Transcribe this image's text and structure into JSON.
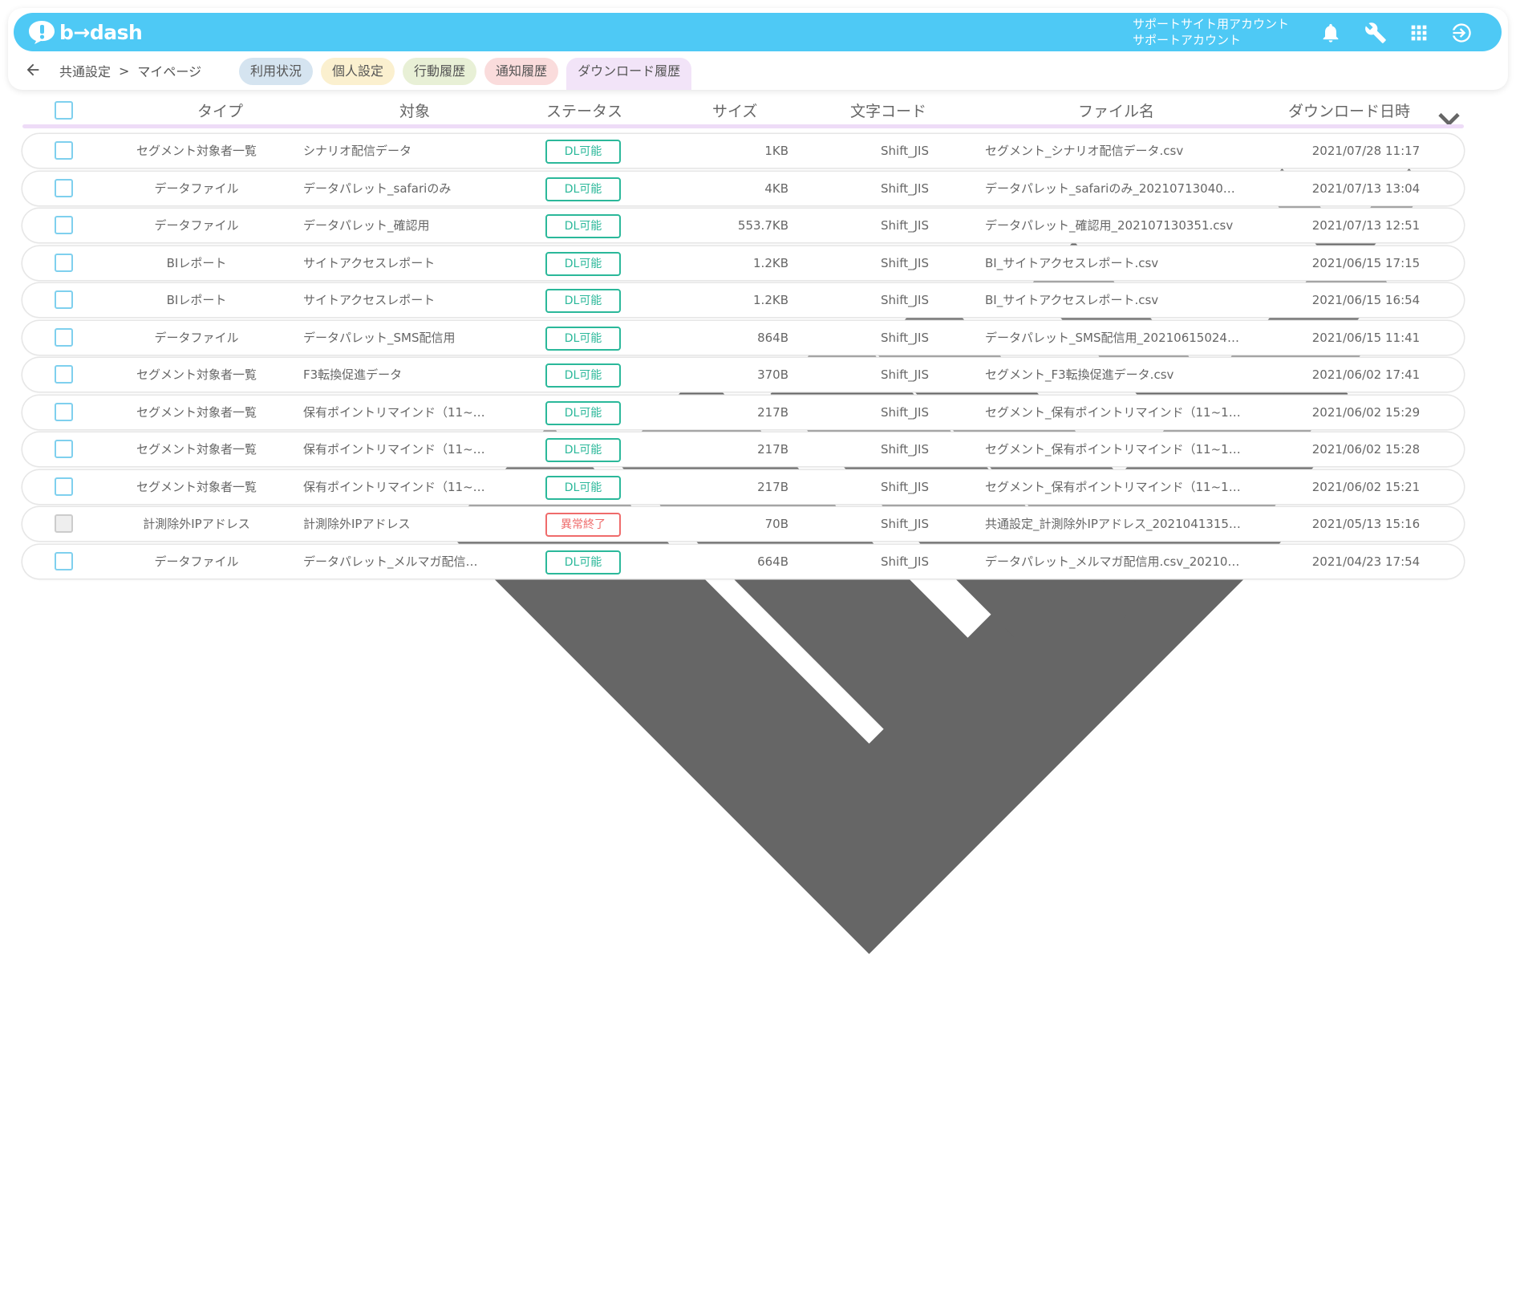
{
  "app": {
    "logo_text": "b→dash",
    "account_line1": "サポートサイト用アカウント",
    "account_line2": "サポートアカウント",
    "icons": [
      "bell-icon",
      "wrench-icon",
      "grid-icon",
      "logout-icon"
    ]
  },
  "breadcrumb": {
    "root": "共通設定",
    "separator": ">",
    "current": "マイページ"
  },
  "tabs": [
    {
      "label": "利用状況",
      "color": "#d5e4f0"
    },
    {
      "label": "個人設定",
      "color": "#fbf0cf"
    },
    {
      "label": "行動履歴",
      "color": "#e8f0d6"
    },
    {
      "label": "通知履歴",
      "color": "#fadcdc"
    },
    {
      "label": "ダウンロード履歴",
      "color": "#f2e4f8",
      "active": true
    }
  ],
  "columns": {
    "type": "タイプ",
    "target": "対象",
    "status": "ステータス",
    "size": "サイズ",
    "encoding": "文字コード",
    "filename": "ファイル名",
    "date": "ダウンロード日時"
  },
  "colors": {
    "topbar": "#4ec9f5",
    "status_ok": "#2bb89a",
    "status_err": "#ef6b6b",
    "header_line": "#eedcf7",
    "checkbox": "#7fd0ee"
  },
  "rows": [
    {
      "type": "セグメント対象者一覧",
      "target": "シナリオ配信データ",
      "status": "DL可能",
      "size": "1KB",
      "encoding": "Shift_JIS",
      "filename": "セグメント_シナリオ配信データ.csv",
      "date": "2021/07/28 11:17"
    },
    {
      "type": "データファイル",
      "target": "データパレット_safariのみ",
      "status": "DL可能",
      "size": "4KB",
      "encoding": "Shift_JIS",
      "filename": "データパレット_safariのみ_20210713040…",
      "date": "2021/07/13 13:04"
    },
    {
      "type": "データファイル",
      "target": "データパレット_確認用",
      "status": "DL可能",
      "size": "553.7KB",
      "encoding": "Shift_JIS",
      "filename": "データパレット_確認用_202107130351.csv",
      "date": "2021/07/13 12:51"
    },
    {
      "type": "BIレポート",
      "target": "サイトアクセスレポート",
      "status": "DL可能",
      "size": "1.2KB",
      "encoding": "Shift_JIS",
      "filename": "BI_サイトアクセスレポート.csv",
      "date": "2021/06/15 17:15"
    },
    {
      "type": "BIレポート",
      "target": "サイトアクセスレポート",
      "status": "DL可能",
      "size": "1.2KB",
      "encoding": "Shift_JIS",
      "filename": "BI_サイトアクセスレポート.csv",
      "date": "2021/06/15 16:54"
    },
    {
      "type": "データファイル",
      "target": "データパレット_SMS配信用",
      "status": "DL可能",
      "size": "864B",
      "encoding": "Shift_JIS",
      "filename": "データパレット_SMS配信用_20210615024…",
      "date": "2021/06/15 11:41"
    },
    {
      "type": "セグメント対象者一覧",
      "target": "F3転換促進データ",
      "status": "DL可能",
      "size": "370B",
      "encoding": "Shift_JIS",
      "filename": "セグメント_F3転換促進データ.csv",
      "date": "2021/06/02 17:41"
    },
    {
      "type": "セグメント対象者一覧",
      "target": "保有ポイントリマインド（11~…",
      "status": "DL可能",
      "size": "217B",
      "encoding": "Shift_JIS",
      "filename": "セグメント_保有ポイントリマインド（11~1…",
      "date": "2021/06/02 15:29"
    },
    {
      "type": "セグメント対象者一覧",
      "target": "保有ポイントリマインド（11~…",
      "status": "DL可能",
      "size": "217B",
      "encoding": "Shift_JIS",
      "filename": "セグメント_保有ポイントリマインド（11~1…",
      "date": "2021/06/02 15:28"
    },
    {
      "type": "セグメント対象者一覧",
      "target": "保有ポイントリマインド（11~…",
      "status": "DL可能",
      "size": "217B",
      "encoding": "Shift_JIS",
      "filename": "セグメント_保有ポイントリマインド（11~1…",
      "date": "2021/06/02 15:21"
    },
    {
      "type": "計測除外IPアドレス",
      "target": "計測除外IPアドレス",
      "status": "異常終了",
      "size": "70B",
      "encoding": "Shift_JIS",
      "filename": "共通設定_計測除外IPアドレス_2021041315…",
      "date": "2021/05/13 15:16",
      "error": true
    },
    {
      "type": "データファイル",
      "target": "データパレット_メルマガ配信…",
      "status": "DL可能",
      "size": "664B",
      "encoding": "Shift_JIS",
      "filename": "データパレット_メルマガ配信用.csv_20210…",
      "date": "2021/04/23 17:54"
    }
  ]
}
